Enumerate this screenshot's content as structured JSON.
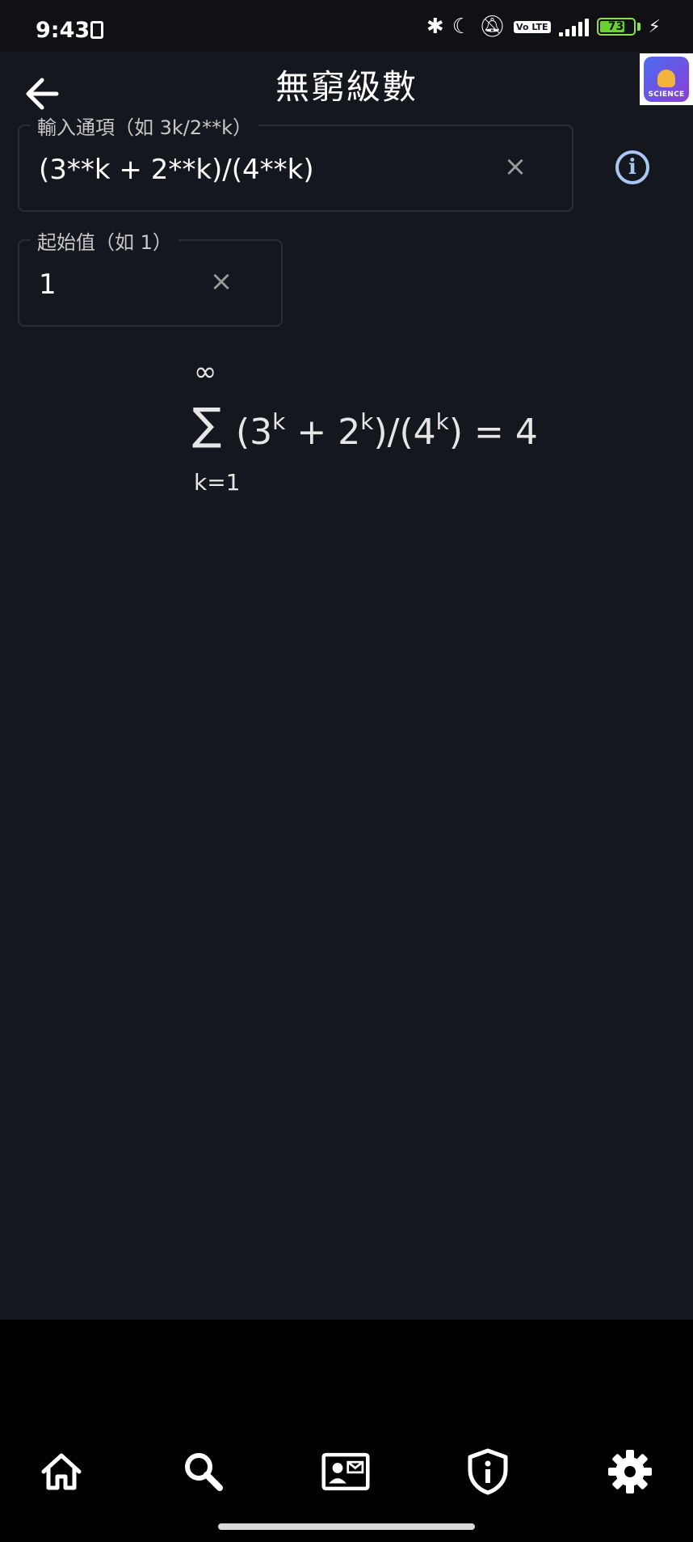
{
  "status_bar": {
    "time": "9:43",
    "volte_label": "Vo LTE",
    "battery_level": "73"
  },
  "header": {
    "title": "無窮級數",
    "badge_text": "SCIENCE"
  },
  "term_input": {
    "label": "輸入通項（如 3k/2**k）",
    "value": "(3**k + 2**k)/(4**k)",
    "clear_glyph": "×"
  },
  "start_input": {
    "label": "起始值（如 1）",
    "value": "1",
    "clear_glyph": "×"
  },
  "info_glyph": "i",
  "result": {
    "upper_limit": "∞",
    "sum_symbol": "∑",
    "lower_limit": "k=1",
    "expression": {
      "open_paren": "(3",
      "exp1": "k",
      "plus": " + 2",
      "exp2": "k",
      "middle": ")/(4",
      "exp3": "k",
      "close": ") = 4"
    }
  },
  "bottom_nav": {
    "items": [
      "home-icon",
      "search-icon",
      "contact-card-icon",
      "shield-info-icon",
      "settings-gear-icon"
    ]
  },
  "colors": {
    "background": "#14171d",
    "accent": "#a9c7f2",
    "battery": "#6bd12f"
  }
}
